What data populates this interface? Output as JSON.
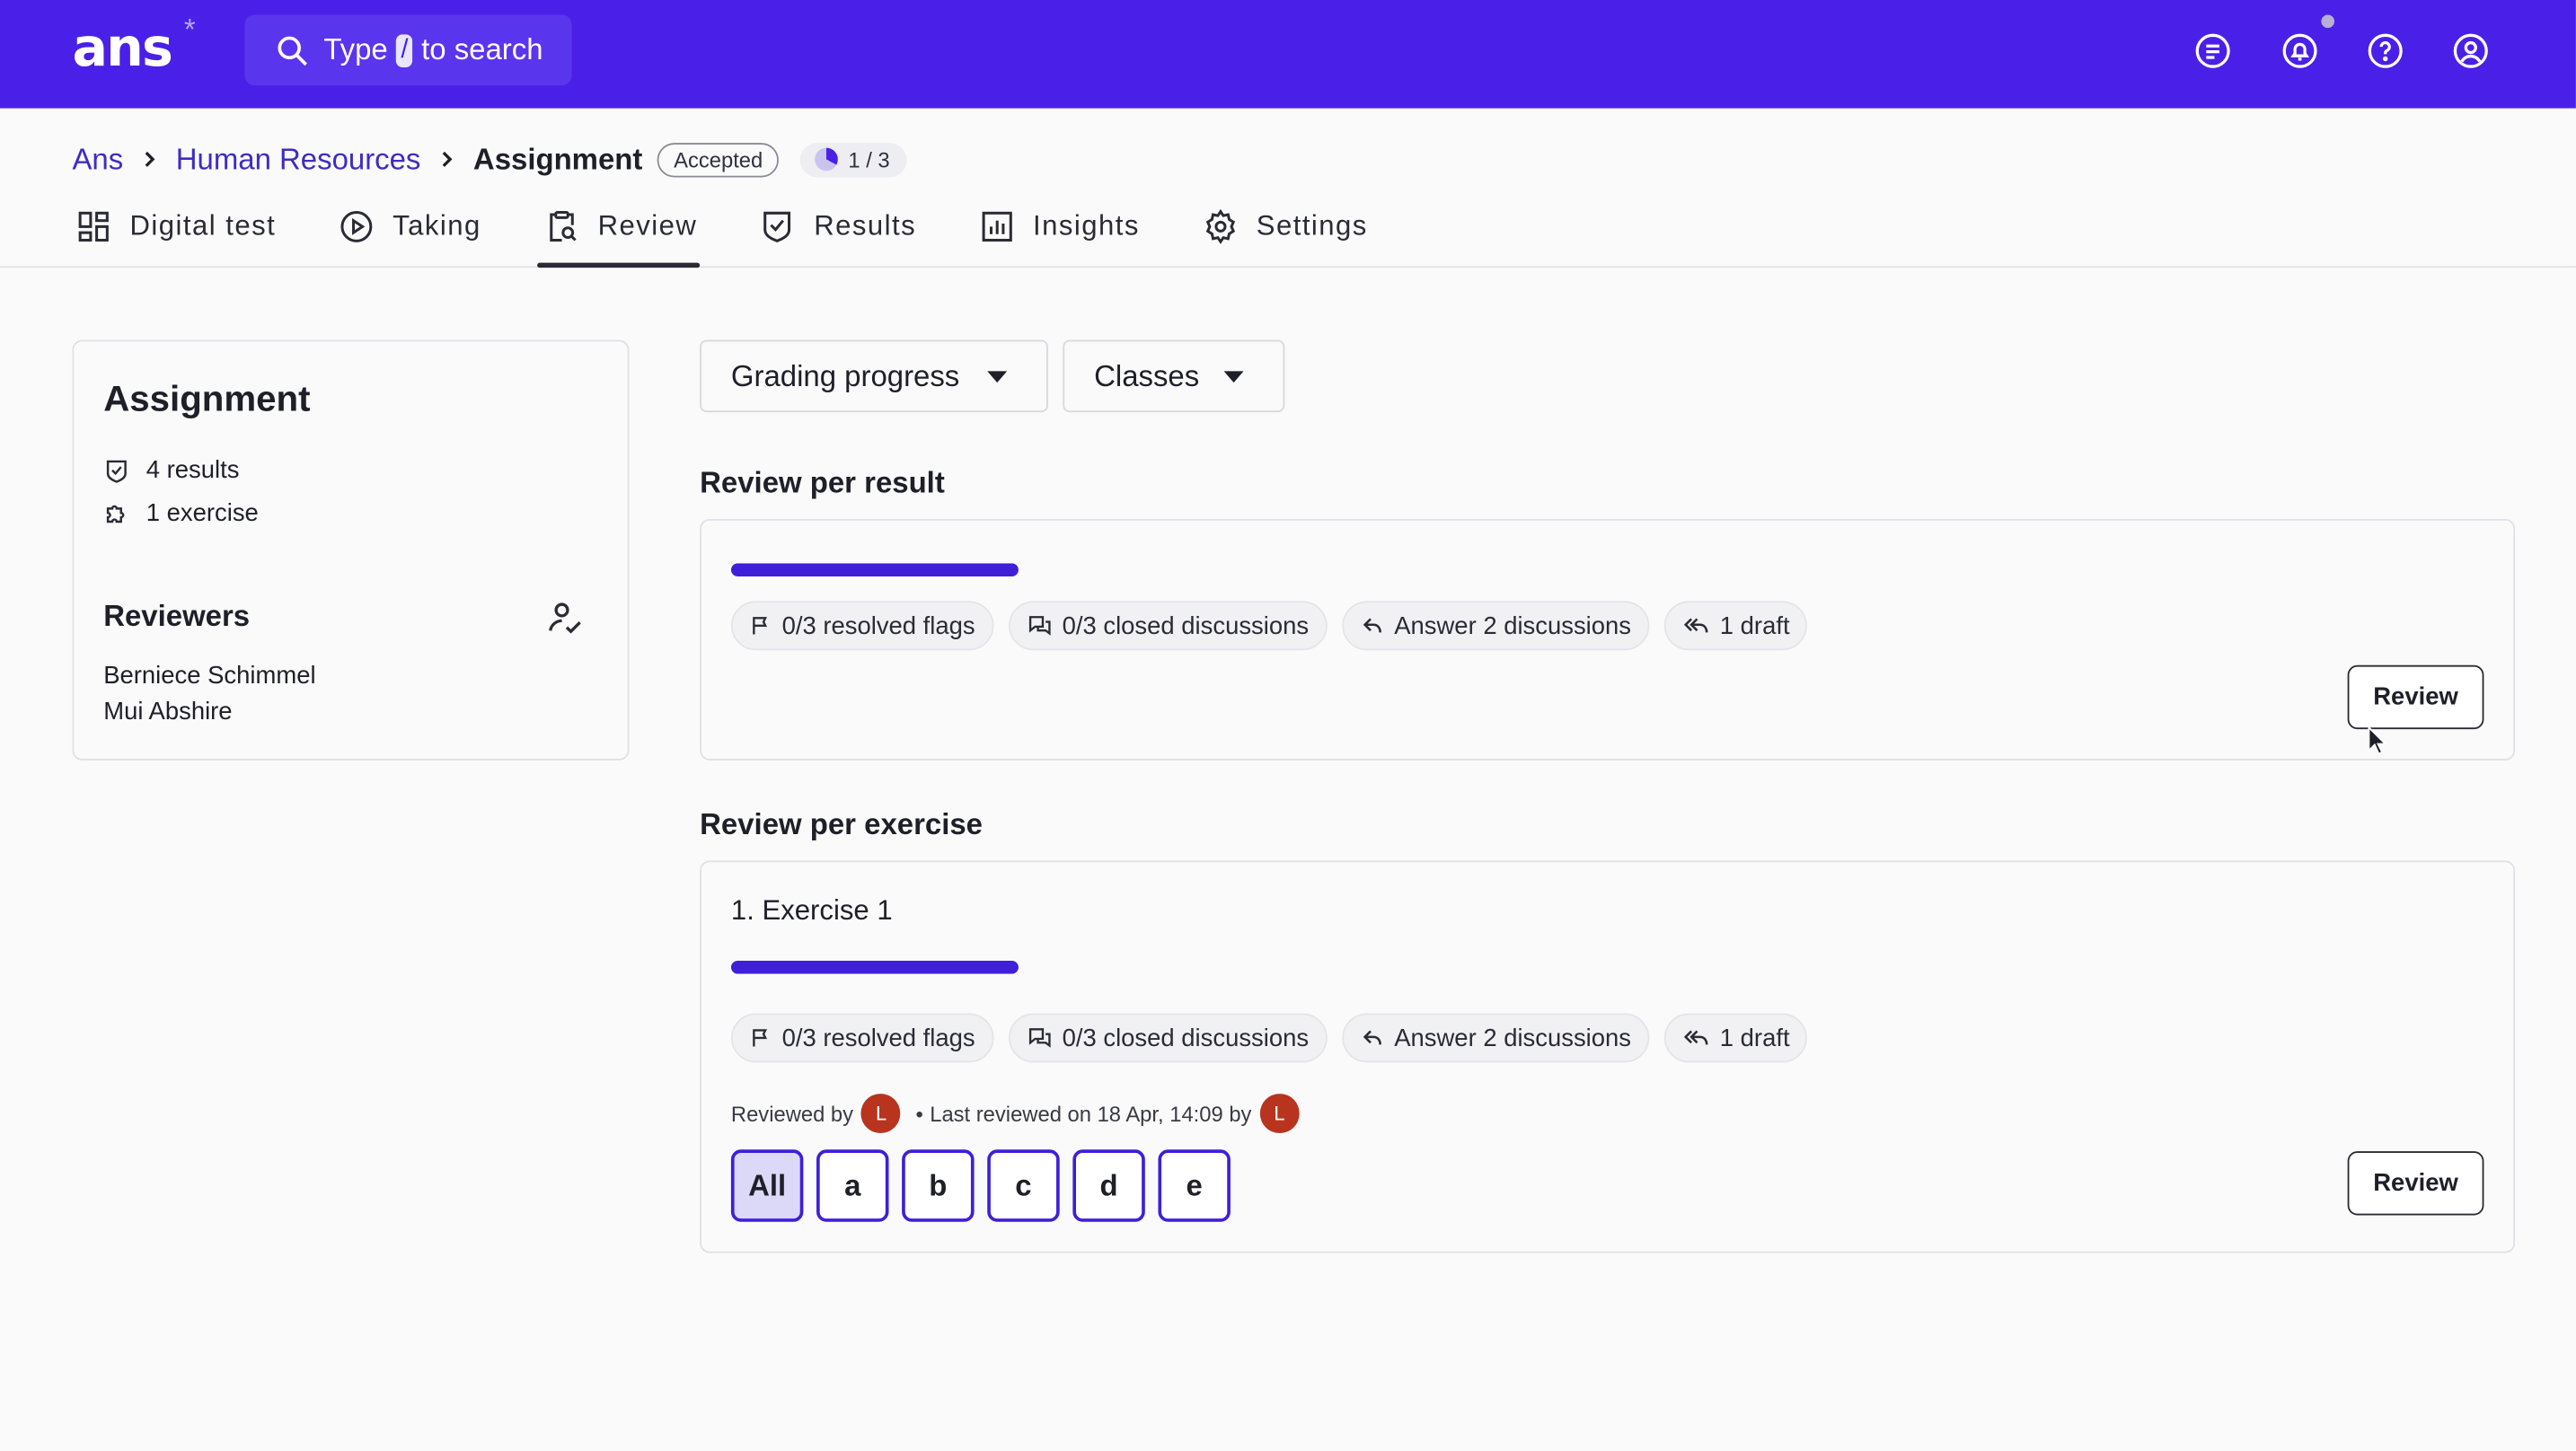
{
  "app": {
    "logo": "ans",
    "search_prefix": "Type",
    "search_key": "/",
    "search_suffix": "to search",
    "icons": [
      "feedback-icon",
      "bell-icon",
      "help-icon",
      "account-icon"
    ]
  },
  "breadcrumb": {
    "items": [
      "Ans",
      "Human Resources"
    ],
    "current": "Assignment",
    "status": "Accepted",
    "progress": "1 / 3"
  },
  "tabs": [
    {
      "label": "Digital test",
      "icon": "grid-icon"
    },
    {
      "label": "Taking",
      "icon": "play-icon"
    },
    {
      "label": "Review",
      "icon": "clipboard-search-icon",
      "active": true
    },
    {
      "label": "Results",
      "icon": "shield-check-icon"
    },
    {
      "label": "Insights",
      "icon": "chart-icon"
    },
    {
      "label": "Settings",
      "icon": "gear-icon"
    }
  ],
  "sidebar": {
    "title": "Assignment",
    "results": "4 results",
    "exercises": "1 exercise",
    "reviewers_title": "Reviewers",
    "reviewers": [
      "Berniece Schimmel",
      "Mui Abshire"
    ]
  },
  "filters": {
    "grading_progress": "Grading progress",
    "classes": "Classes"
  },
  "review_per_result": {
    "title": "Review per result",
    "progress": 1.0,
    "chips": {
      "flags": "0/3 resolved flags",
      "closed": "0/3 closed discussions",
      "answer": "Answer 2 discussions",
      "draft": "1 draft"
    },
    "button": "Review"
  },
  "review_per_exercise": {
    "title": "Review per exercise",
    "exercise_title": "1. Exercise 1",
    "progress": 1.0,
    "chips": {
      "flags": "0/3 resolved flags",
      "closed": "0/3 closed discussions",
      "answer": "Answer 2 discussions",
      "draft": "1 draft"
    },
    "reviewed_by": "Reviewed by",
    "avatar_initial": "L",
    "separator": "•",
    "last_reviewed": "Last reviewed on 18 Apr, 14:09 by",
    "parts": [
      "All",
      "a",
      "b",
      "c",
      "d",
      "e"
    ],
    "button": "Review"
  }
}
